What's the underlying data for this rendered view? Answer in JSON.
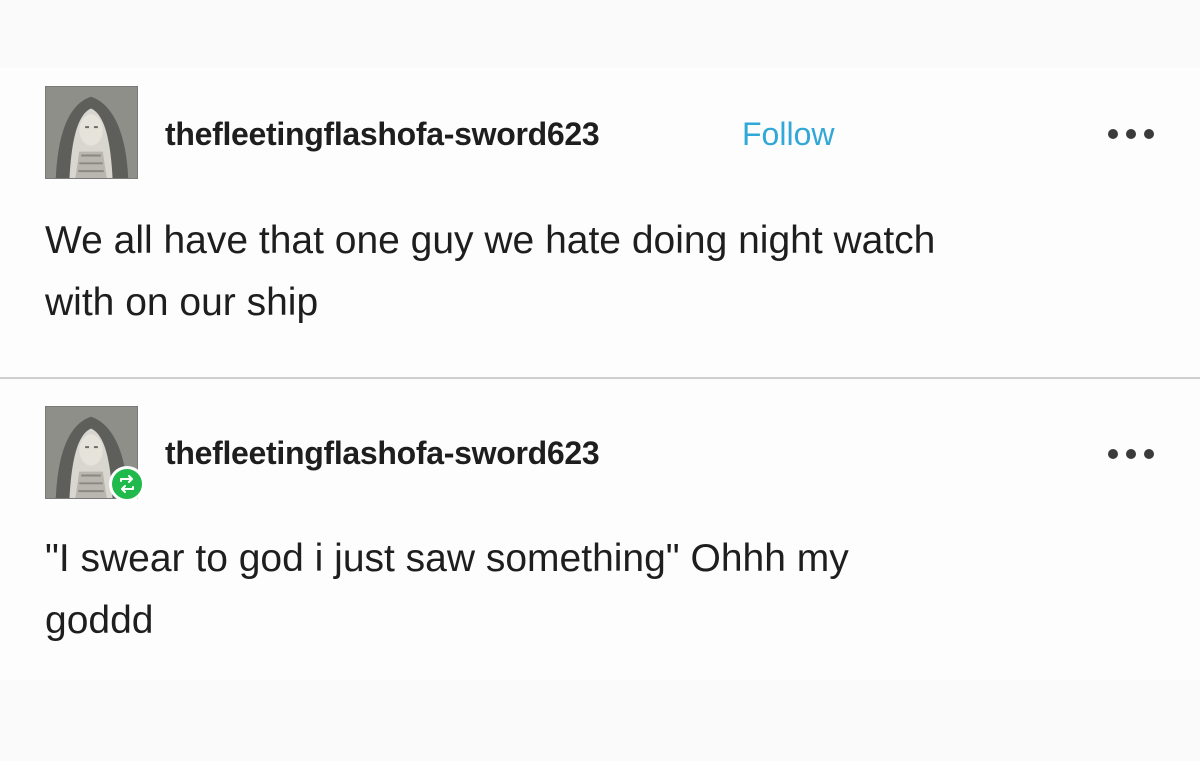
{
  "posts": [
    {
      "username": "thefleetingflashofa-sword623",
      "follow_label": "Follow",
      "avatar_icon": "portrait-avatar",
      "menu_icon": "more-options-icon",
      "body_line1": "We all have that one guy we hate doing night watch",
      "body_line2": "with on our ship"
    },
    {
      "username": "thefleetingflashofa-sword623",
      "avatar_icon": "portrait-avatar",
      "badge_icon": "reblog-icon",
      "menu_icon": "more-options-icon",
      "body_line1": "\"I swear to god i just saw something\" Ohhh my",
      "body_line2": "goddd"
    }
  ],
  "colors": {
    "follow": "#32a8d8",
    "reblog_badge": "#1fb94c",
    "text": "#1e1e1e",
    "divider": "#cfcfcf"
  }
}
